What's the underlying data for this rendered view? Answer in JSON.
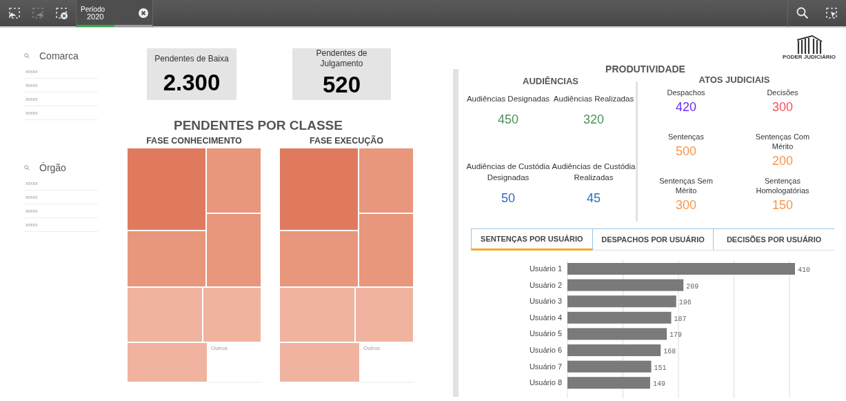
{
  "toolbar": {
    "buttons": [
      {
        "kind": "back",
        "disabled": false
      },
      {
        "kind": "forward",
        "disabled": true
      },
      {
        "kind": "clear",
        "disabled": false
      }
    ],
    "selection": {
      "label": "Período",
      "value": "2020",
      "level": 0.5
    },
    "right_buttons": [
      {
        "kind": "search"
      },
      {
        "kind": "select"
      }
    ]
  },
  "filters": [
    {
      "title": "Comarca",
      "items": [
        "xxxxx",
        "xxxxx",
        "xxxxx",
        "xxxxx"
      ]
    },
    {
      "title": "Órgão",
      "items": [
        "xxxxx",
        "xxxxx",
        "xxxxx",
        "xxxxx"
      ]
    }
  ],
  "kpis": [
    {
      "label": "Pendentes de Baixa",
      "value": "2.300"
    },
    {
      "label": "Pendentes de Julgamento",
      "value": "520"
    }
  ],
  "pendentes": {
    "title": "PENDENTES POR CLASSE",
    "treemaps": [
      {
        "title": "FASE CONHECIMENTO",
        "other_label": "Outros"
      },
      {
        "title": "FASE EXECUÇÃO",
        "other_label": "Outros"
      }
    ]
  },
  "logo": {
    "text": "PODER JUDICIÁRIO"
  },
  "produtividade": {
    "title": "PRODUTIVIDADE",
    "sections": [
      {
        "title": "AUDIÊNCIAS",
        "metrics": [
          {
            "label": "Audiências Designadas",
            "value": "450",
            "color": "#4a9256"
          },
          {
            "label": "Audiências Realizadas",
            "value": "320",
            "color": "#4a9256"
          },
          {
            "label": "Audiências de Custódia Designadas",
            "value": "50",
            "color": "#2a6ebf"
          },
          {
            "label": "Audiências de Custódia Realizadas",
            "value": "45",
            "color": "#2a6ebf"
          }
        ]
      },
      {
        "title": "ATOS JUDICIAIS",
        "metrics": [
          {
            "label": "Despachos",
            "value": "420",
            "color": "#6a2cf0"
          },
          {
            "label": "Decisões",
            "value": "300",
            "color": "#f0525a"
          },
          {
            "label": "Sentenças",
            "value": "500",
            "color": "#f5964f"
          },
          {
            "label": "Sentenças Com Mérito",
            "value": "200",
            "color": "#f5964f"
          },
          {
            "label": "Sentenças Sem Mérito",
            "value": "300",
            "color": "#f5964f"
          },
          {
            "label": "Sentenças Homologatórias",
            "value": "150",
            "color": "#f5964f"
          }
        ]
      }
    ]
  },
  "tabs": [
    {
      "label": "SENTENÇAS POR USUÁRIO",
      "selected": true
    },
    {
      "label": "DESPACHOS POR USUÁRIO",
      "selected": false
    },
    {
      "label": "DECISÕES POR USUÁRIO",
      "selected": false
    }
  ],
  "chart_data": {
    "type": "bar",
    "orientation": "horizontal",
    "data_labels": true,
    "categories": [
      "Usuário 1",
      "Usuário 2",
      "Usuário 3",
      "Usuário 4",
      "Usuário 5",
      "Usuário 6",
      "Usuário 7",
      "Usuário 8"
    ],
    "values": [
      410,
      209,
      196,
      187,
      179,
      168,
      151,
      149
    ]
  }
}
